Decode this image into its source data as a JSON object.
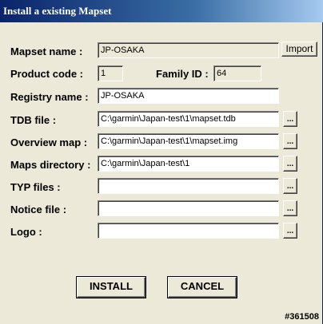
{
  "window": {
    "title": "Install a existing Mapset"
  },
  "mapset_name": {
    "label": "Mapset name :",
    "value": "JP-OSAKA",
    "import_label": "Import"
  },
  "product_code": {
    "label": "Product code :",
    "value": "1"
  },
  "family_id": {
    "label": "Family ID :",
    "value": "64"
  },
  "registry_name": {
    "label": "Registry name :",
    "value": "JP-OSAKA"
  },
  "tdb_file": {
    "label": "TDB file :",
    "value": "C:\\garmin\\Japan-test\\1\\mapset.tdb"
  },
  "overview_map": {
    "label": "Overview map :",
    "value": "C:\\garmin\\Japan-test\\1\\mapset.img"
  },
  "maps_directory": {
    "label": "Maps directory :",
    "value": "C:\\garmin\\Japan-test\\1"
  },
  "typ_files": {
    "label": "TYP files :",
    "value": ""
  },
  "notice_file": {
    "label": "Notice file :",
    "value": ""
  },
  "logo": {
    "label": "Logo :",
    "value": ""
  },
  "browse_label": "...",
  "buttons": {
    "install": "INSTALL",
    "cancel": "CANCEL"
  },
  "footer": {
    "id": "#361508"
  }
}
